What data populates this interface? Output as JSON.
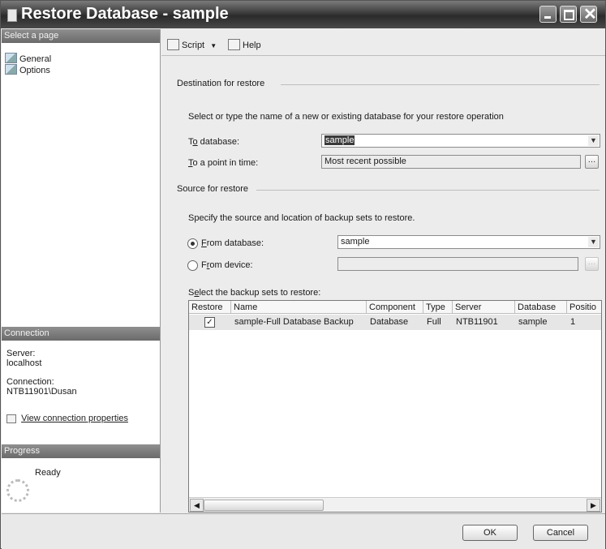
{
  "window": {
    "title": "Restore Database - sample"
  },
  "left": {
    "select_page": "Select a page",
    "pages": [
      "General",
      "Options"
    ],
    "connection_header": "Connection",
    "server_label": "Server:",
    "server_value": "localhost",
    "connection_label": "Connection:",
    "connection_value": "NTB11901\\Dusan",
    "view_props": "View connection properties",
    "progress_header": "Progress",
    "status": "Ready"
  },
  "toolbar": {
    "script": "Script",
    "help": "Help"
  },
  "destination": {
    "legend": "Destination for restore",
    "instruction": "Select or type the name of a new or existing database for your restore operation",
    "to_db_label_ul": "o",
    "to_db_label_pre": "T",
    "to_db_label_post": " database:",
    "to_db_value": "sample",
    "point_label_ul": "T",
    "point_label_post": "o a point in time:",
    "point_value": "Most recent possible"
  },
  "source": {
    "legend": "Source for restore",
    "instruction": "Specify the source and location of backup sets to restore.",
    "from_db_ul": "F",
    "from_db_post": "rom database:",
    "from_db_value": "sample",
    "from_device_ul": "r",
    "from_device_pre": "F",
    "from_device_post": "om device:",
    "from_device_value": "",
    "backup_sets_pre": "S",
    "backup_sets_ul": "e",
    "backup_sets_post": "lect the backup sets to restore:"
  },
  "grid": {
    "headers": [
      "Restore",
      "Name",
      "Component",
      "Type",
      "Server",
      "Database",
      "Positio"
    ],
    "rows": [
      {
        "restore": true,
        "name": "sample-Full Database Backup",
        "component": "Database",
        "type": "Full",
        "server": "NTB11901",
        "database": "sample",
        "position": "1"
      }
    ]
  },
  "buttons": {
    "ok": "OK",
    "cancel": "Cancel"
  }
}
